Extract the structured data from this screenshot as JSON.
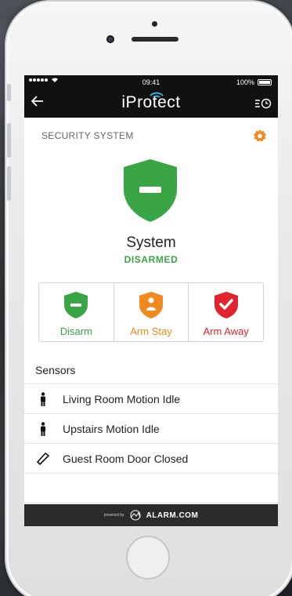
{
  "status_bar": {
    "time": "09:41",
    "battery": "100%"
  },
  "app_bar": {
    "title": "iProtect"
  },
  "security": {
    "header": "SECURITY SYSTEM",
    "title": "System",
    "state": "DISARMED",
    "state_color": "#3aa545"
  },
  "modes": [
    {
      "label": "Disarm",
      "color": "#3aa545",
      "icon": "shield-minus-icon"
    },
    {
      "label": "Arm Stay",
      "color": "#f08a1f",
      "icon": "shield-person-icon"
    },
    {
      "label": "Arm Away",
      "color": "#e2232e",
      "icon": "shield-check-icon"
    }
  ],
  "sensors_title": "Sensors",
  "sensors": [
    {
      "label": "Living Room Motion Idle",
      "icon": "person-icon"
    },
    {
      "label": "Upstairs Motion Idle",
      "icon": "person-icon"
    },
    {
      "label": "Guest  Room Door Closed",
      "icon": "door-icon"
    }
  ],
  "footer": {
    "powered_by": "powered by",
    "brand": "ALARM.COM"
  },
  "accent_color": "#f08a1f"
}
